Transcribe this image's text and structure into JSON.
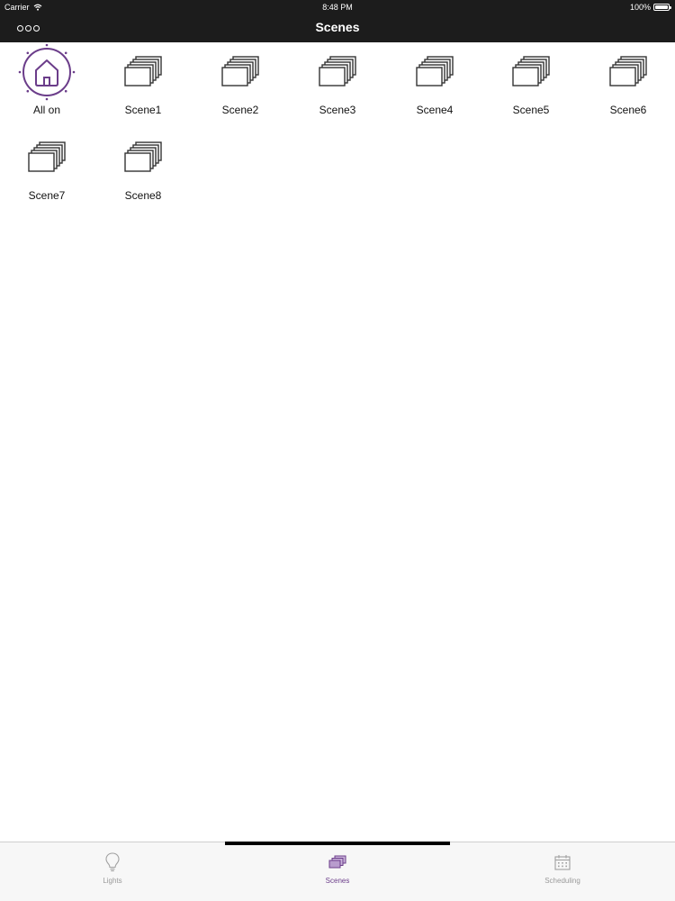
{
  "status_bar": {
    "carrier": "Carrier",
    "time": "8:48 PM",
    "battery": "100%"
  },
  "nav": {
    "title": "Scenes",
    "more_icon": "more-icon"
  },
  "scenes": [
    {
      "label": "All on",
      "icon": "home-icon"
    },
    {
      "label": "Scene1",
      "icon": "scene-stack-icon"
    },
    {
      "label": "Scene2",
      "icon": "scene-stack-icon"
    },
    {
      "label": "Scene3",
      "icon": "scene-stack-icon"
    },
    {
      "label": "Scene4",
      "icon": "scene-stack-icon"
    },
    {
      "label": "Scene5",
      "icon": "scene-stack-icon"
    },
    {
      "label": "Scene6",
      "icon": "scene-stack-icon"
    },
    {
      "label": "Scene7",
      "icon": "scene-stack-icon"
    },
    {
      "label": "Scene8",
      "icon": "scene-stack-icon"
    }
  ],
  "tabbar": {
    "tabs": [
      {
        "label": "Lights",
        "icon": "bulb-icon",
        "active": false
      },
      {
        "label": "Scenes",
        "icon": "scenes-icon",
        "active": true
      },
      {
        "label": "Scheduling",
        "icon": "calendar-icon",
        "active": false
      }
    ]
  },
  "colors": {
    "accent": "#6b3d8a",
    "nav_background": "#1c1c1c",
    "icon_stroke": "#333333"
  }
}
